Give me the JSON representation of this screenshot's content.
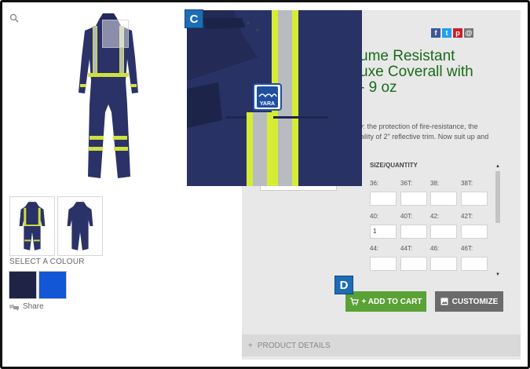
{
  "markers": {
    "c": "C",
    "d": "D"
  },
  "gallery": {
    "colour_label": "SELECT A COLOUR",
    "share_label": "Share"
  },
  "colours": {
    "navy": "#1f2447",
    "blue": "#1356d6"
  },
  "product": {
    "title_lines": [
      "ume Resistant",
      "uxe Coverall with",
      "- 9 oz"
    ],
    "desc_lines": [
      "y: the protection of fire-resistance, the",
      "bility of 2\" reflective trim. Now suit up and"
    ],
    "logo_text": "YARA"
  },
  "social": {
    "facebook": "f",
    "twitter": "t",
    "pinterest": "p",
    "email": "@"
  },
  "sizes": {
    "header": "SIZE/QUANTITY",
    "rows": [
      [
        {
          "label": "36:",
          "value": ""
        },
        {
          "label": "36T:",
          "value": ""
        },
        {
          "label": "38:",
          "value": ""
        },
        {
          "label": "38T:",
          "value": ""
        }
      ],
      [
        {
          "label": "40:",
          "value": "1"
        },
        {
          "label": "40T:",
          "value": ""
        },
        {
          "label": "42:",
          "value": ""
        },
        {
          "label": "42T:",
          "value": ""
        }
      ],
      [
        {
          "label": "44:",
          "value": ""
        },
        {
          "label": "44T:",
          "value": ""
        },
        {
          "label": "46:",
          "value": ""
        },
        {
          "label": "46T:",
          "value": ""
        }
      ]
    ]
  },
  "actions": {
    "add_to_cart": "+ ADD TO CART",
    "customize": "CUSTOMIZE"
  },
  "details": {
    "label": "PRODUCT DETAILS",
    "prefix": "+"
  }
}
